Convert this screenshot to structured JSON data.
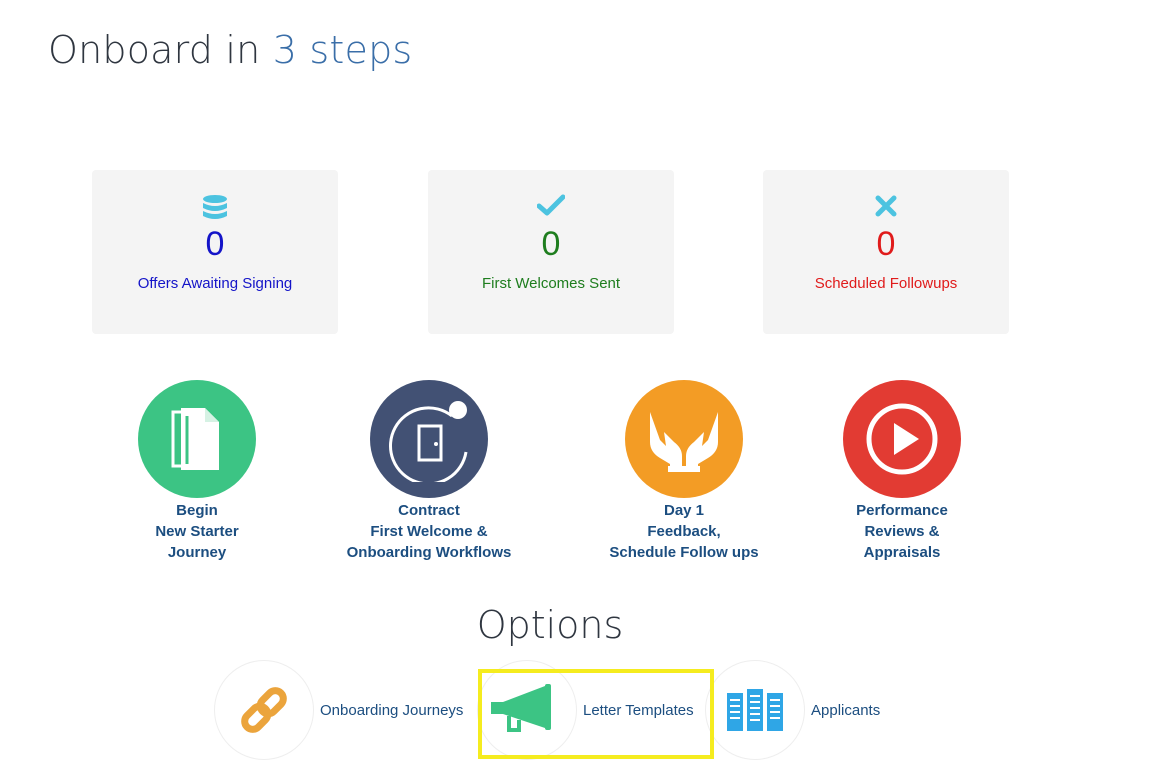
{
  "header": {
    "title_prefix": "Onboard in",
    "title_accent": "3 steps",
    "accent_color": "#3a6ea8"
  },
  "stats": [
    {
      "icon": "database-icon",
      "value": "0",
      "label": "Offers Awaiting Signing",
      "color": "#1414c8",
      "icon_color": "#4cc3e0"
    },
    {
      "icon": "check-icon",
      "value": "0",
      "label": "First Welcomes Sent",
      "color": "#1e7d1e",
      "icon_color": "#4cc3e0"
    },
    {
      "icon": "x-icon",
      "value": "0",
      "label": "Scheduled Followups",
      "color": "#e01b1b",
      "icon_color": "#4cc3e0"
    }
  ],
  "steps": [
    {
      "icon": "documents-icon",
      "color": "#3cc484",
      "lines": [
        "Begin",
        "New Starter",
        "Journey"
      ]
    },
    {
      "icon": "door-icon",
      "color": "#425174",
      "lines": [
        "Contract",
        "First Welcome &",
        "Onboarding Workflows"
      ]
    },
    {
      "icon": "hands-icon",
      "color": "#f39c25",
      "lines": [
        "Day 1",
        "Feedback,",
        "Schedule Follow ups"
      ]
    },
    {
      "icon": "play-icon",
      "color": "#e23b33",
      "lines": [
        "Performance",
        "Reviews &",
        "Appraisals"
      ]
    }
  ],
  "options_title": "Options",
  "options": [
    {
      "icon": "link-icon",
      "label": "Onboarding Journeys",
      "icon_color": "#eba43c"
    },
    {
      "icon": "megaphone-icon",
      "label": "Letter Templates",
      "icon_color": "#3cc484"
    },
    {
      "icon": "server-icon",
      "label": "Applicants",
      "icon_color": "#2fa6e6"
    }
  ],
  "highlight_color": "#f5ec1f"
}
